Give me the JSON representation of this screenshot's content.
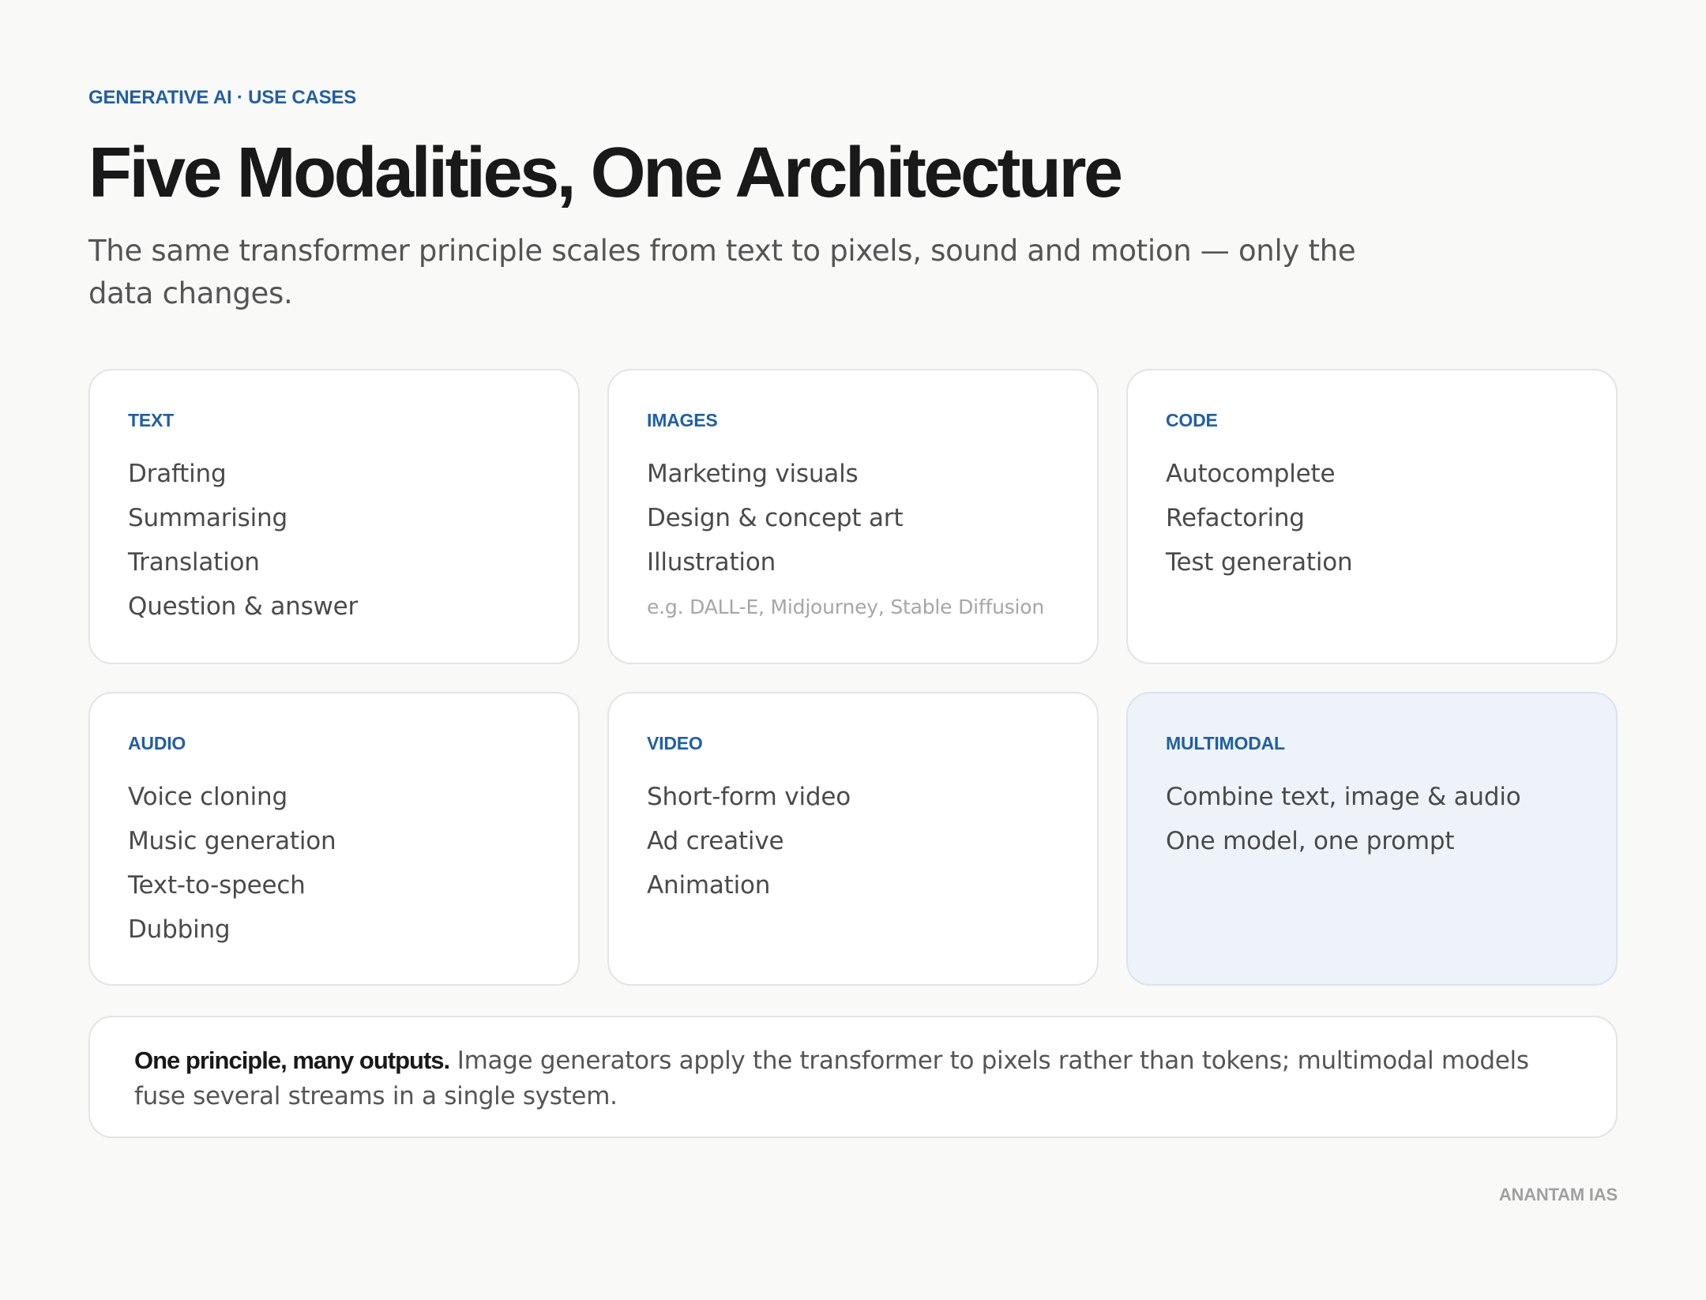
{
  "header": {
    "eyebrow": "GENERATIVE AI · USE CASES",
    "title": "Five Modalities, One Architecture",
    "subtitle": "The same transformer principle scales from text to pixels, sound and motion — only the data changes."
  },
  "cards": [
    {
      "label": "TEXT",
      "items": [
        "Drafting",
        "Summarising",
        "Translation",
        "Question & answer"
      ],
      "note": ""
    },
    {
      "label": "IMAGES",
      "items": [
        "Marketing visuals",
        "Design & concept art",
        "Illustration"
      ],
      "note": "e.g. DALL-E, Midjourney, Stable Diffusion"
    },
    {
      "label": "CODE",
      "items": [
        "Autocomplete",
        "Refactoring",
        "Test generation"
      ],
      "note": ""
    },
    {
      "label": "AUDIO",
      "items": [
        "Voice cloning",
        "Music generation",
        "Text-to-speech",
        "Dubbing"
      ],
      "note": ""
    },
    {
      "label": "VIDEO",
      "items": [
        "Short-form video",
        "Ad creative",
        "Animation"
      ],
      "note": ""
    },
    {
      "label": "MULTIMODAL",
      "items": [
        "Combine text, image & audio",
        "One model, one prompt"
      ],
      "note": ""
    }
  ],
  "callout": {
    "strong": "One principle, many outputs.",
    "text": " Image generators apply the transformer to pixels rather than tokens; multimodal models fuse several streams in a single system."
  },
  "footer": {
    "brand": "ANANTAM IAS"
  },
  "colors": {
    "accent": "#1f5fa6",
    "background": "#f9f9f7",
    "highlight_card": "#eef3f9"
  }
}
